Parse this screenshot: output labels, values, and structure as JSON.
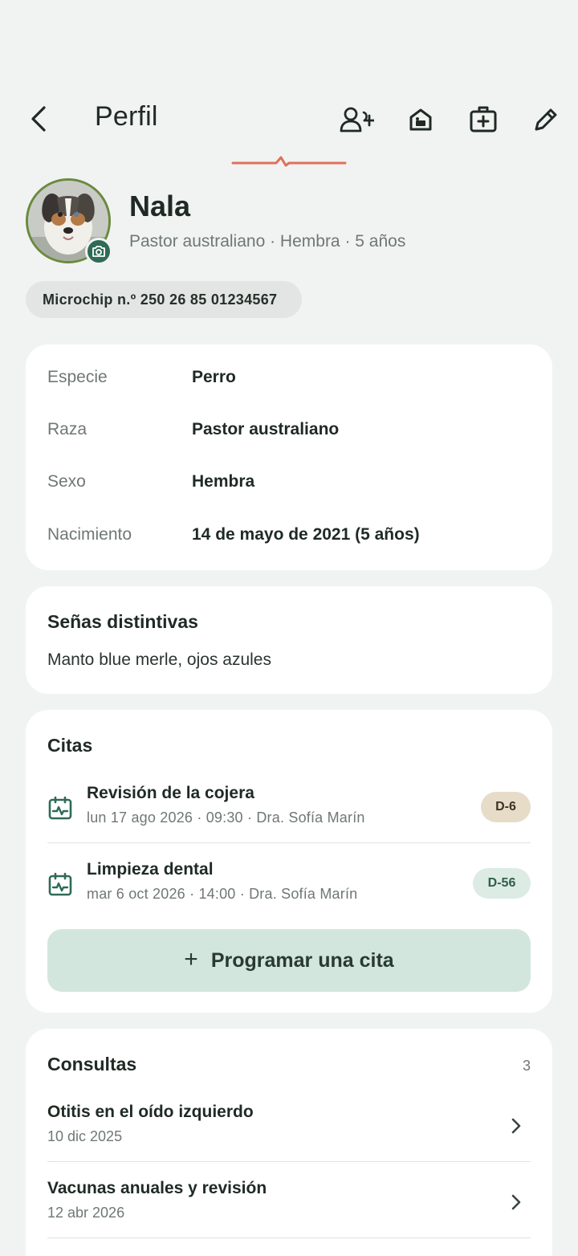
{
  "header": {
    "title": "Perfil",
    "actions": [
      "add-owner-icon",
      "kennel-icon",
      "medical-card-icon",
      "edit-icon"
    ]
  },
  "pet": {
    "name": "Nala",
    "summary": "Pastor australiano · Hembra · 5 años",
    "microchip": "Microchip n.º 250 26 85 01234567"
  },
  "details": [
    {
      "label": "Especie",
      "value": "Perro"
    },
    {
      "label": "Raza",
      "value": "Pastor australiano"
    },
    {
      "label": "Sexo",
      "value": "Hembra"
    },
    {
      "label": "Nacimiento",
      "value": "14 de mayo de 2021 (5 años)"
    }
  ],
  "marks": {
    "title": "Señas distintivas",
    "text": "Manto blue merle, ojos azules"
  },
  "appointments": {
    "title": "Citas",
    "items": [
      {
        "title": "Revisión de la cojera",
        "meta": "lun 17 ago 2026 · 09:30 · Dra. Sofía Marín",
        "badge": "D-6",
        "badge_bg": "#e6dcc8",
        "badge_fg": "#3b3325"
      },
      {
        "title": "Limpieza dental",
        "meta": "mar 6 oct 2026 · 14:00 · Dra. Sofía Marín",
        "badge": "D-56",
        "badge_bg": "#dcebe4",
        "badge_fg": "#2f5e4a"
      }
    ],
    "schedule_label": "Programar una cita",
    "schedule_plus": "+"
  },
  "consults": {
    "title": "Consultas",
    "count": "3",
    "items": [
      {
        "title": "Otitis en el oído izquierdo",
        "date": "10 dic 2025"
      },
      {
        "title": "Vacunas anuales y revisión",
        "date": "12 abr 2026"
      }
    ]
  },
  "colors": {
    "accent": "#2f6b57",
    "pulse": "#e0705b",
    "background": "#f1f3f2",
    "card": "#ffffff"
  }
}
